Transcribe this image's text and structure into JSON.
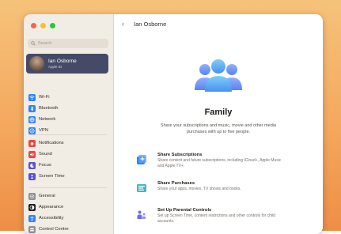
{
  "window": {
    "traffic_lights": [
      "close",
      "minimize",
      "zoom"
    ]
  },
  "sidebar": {
    "search_placeholder": "Search",
    "user": {
      "name": "Ian Osborne",
      "subtitle": "Apple ID"
    },
    "groups": [
      [
        {
          "label": "Wi-Fi",
          "icon": "wifi-icon",
          "color": "#2f82f6"
        },
        {
          "label": "Bluetooth",
          "icon": "bluetooth-icon",
          "color": "#2f82f6"
        },
        {
          "label": "Network",
          "icon": "globe-icon",
          "color": "#2f82f6"
        },
        {
          "label": "VPN",
          "icon": "vpn-icon",
          "color": "#2f82f6"
        }
      ],
      [
        {
          "label": "Notifications",
          "icon": "bell-icon",
          "color": "#f04545"
        },
        {
          "label": "Sound",
          "icon": "speaker-icon",
          "color": "#f04545"
        },
        {
          "label": "Focus",
          "icon": "moon-icon",
          "color": "#5a4fd6"
        },
        {
          "label": "Screen Time",
          "icon": "hourglass-icon",
          "color": "#5a4fd6"
        }
      ],
      [
        {
          "label": "General",
          "icon": "gear-icon",
          "color": "#8e8e93"
        },
        {
          "label": "Appearance",
          "icon": "appearance-icon",
          "color": "#1c1c1e"
        },
        {
          "label": "Accessibility",
          "icon": "accessibility-icon",
          "color": "#2f82f6"
        },
        {
          "label": "Control Centre",
          "icon": "control-centre-icon",
          "color": "#8e8e93"
        }
      ]
    ]
  },
  "main": {
    "back_symbol": "‹",
    "title": "Ian Osborne",
    "family_title": "Family",
    "family_description": "Share your subscriptions and music, movie and other media purchases with up to five people.",
    "features": [
      {
        "title": "Share Subscriptions",
        "description": "Share content and future subscriptions, including iCloud+, Apple Music and Apple TV+.",
        "icon": "subscriptions-icon",
        "color": "#2f82f6"
      },
      {
        "title": "Share Purchases",
        "description": "Share your apps, movies, TV shows and books.",
        "icon": "purchases-icon",
        "color": "#3fb8c9"
      },
      {
        "title": "Set Up Parental Controls",
        "description": "Set up Screen Time, content restrictions and other controls for child accounts.",
        "icon": "parental-controls-icon",
        "color": "#6d6ee8"
      }
    ]
  }
}
